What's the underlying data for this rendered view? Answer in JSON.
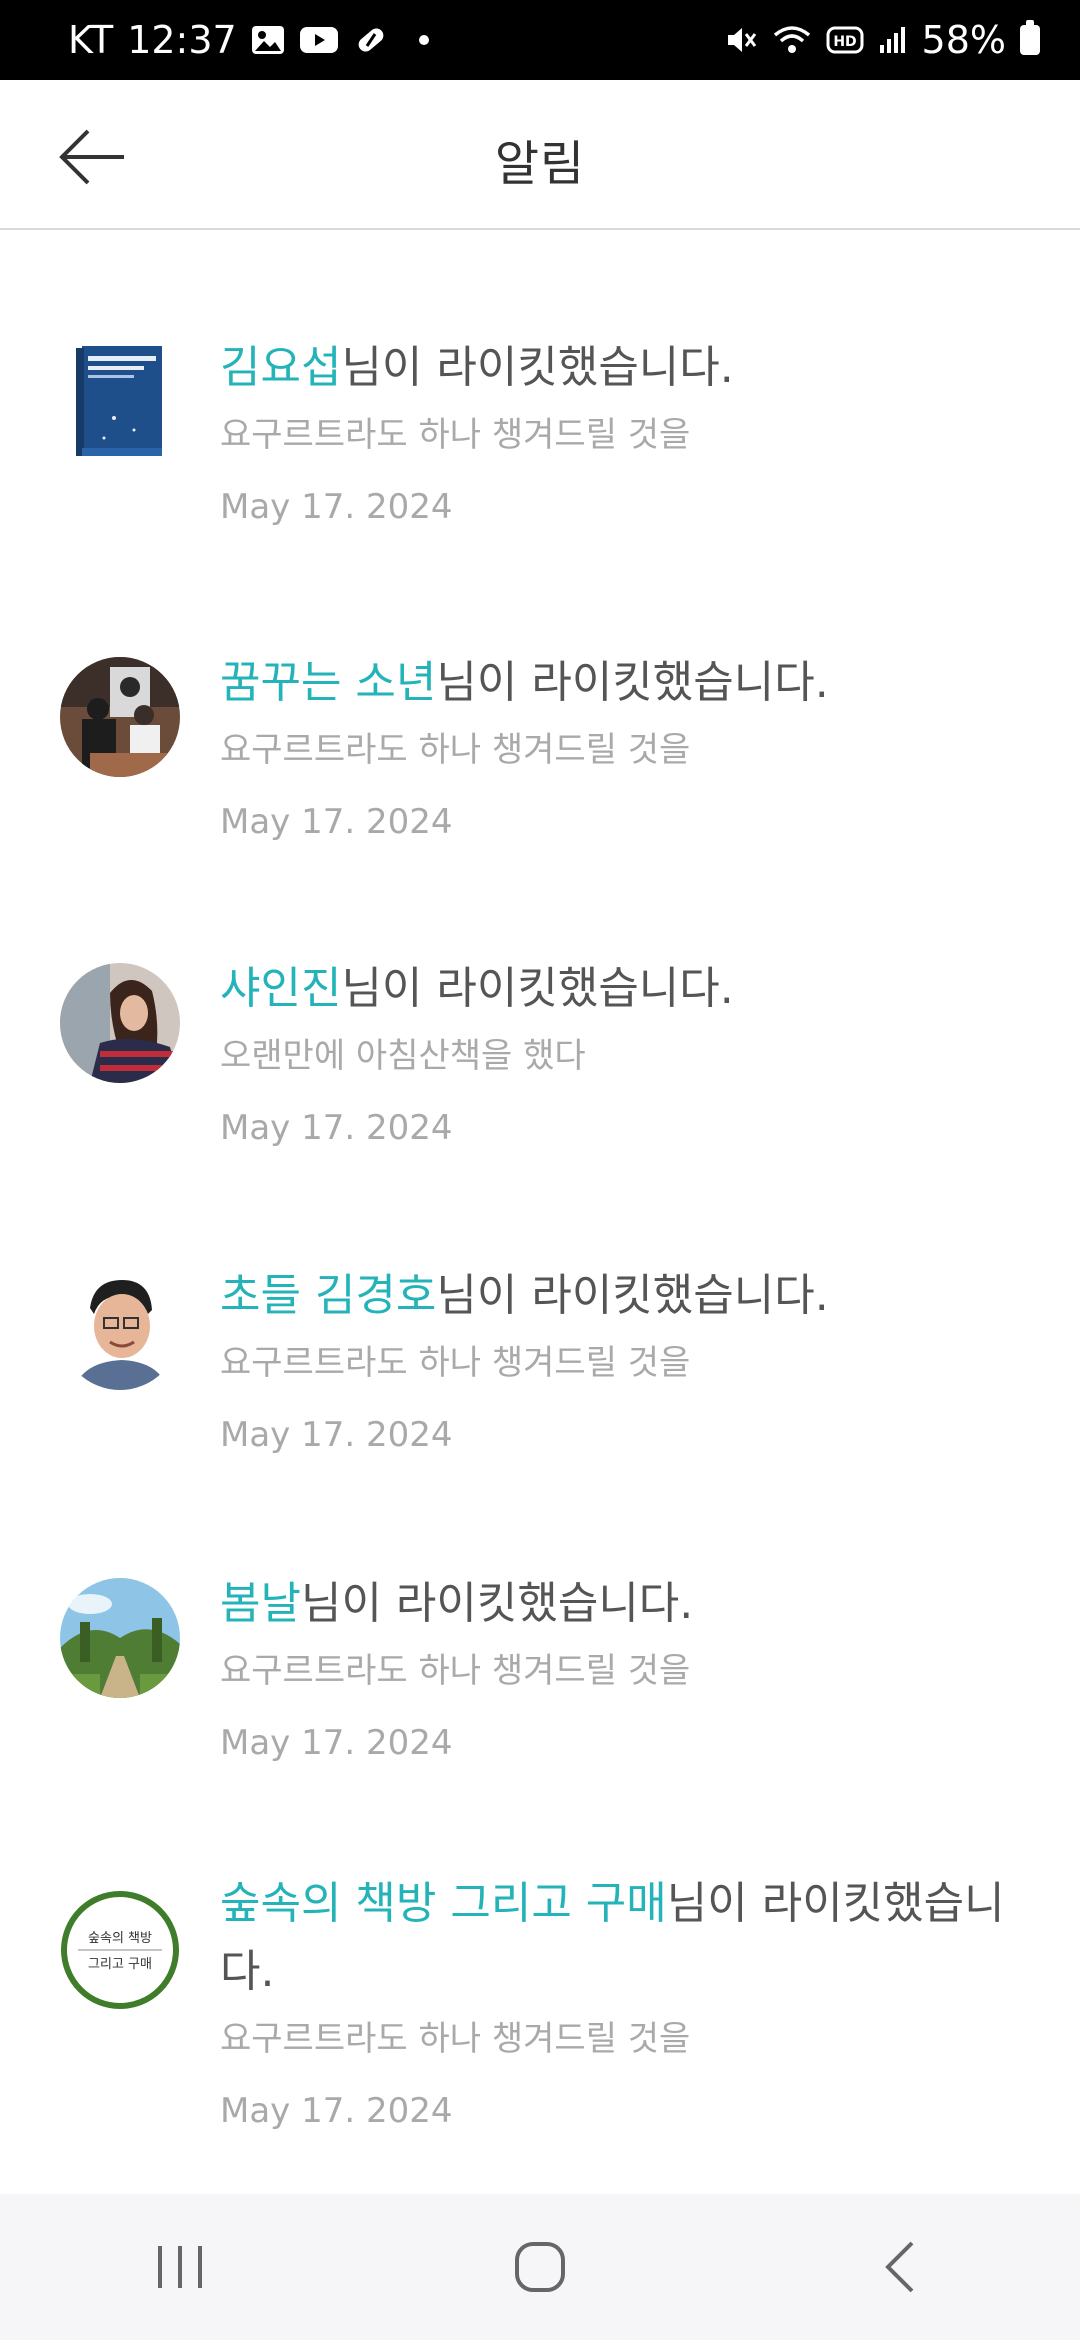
{
  "status_bar": {
    "carrier": "KT",
    "time": "12:37",
    "battery": "58%",
    "icons": [
      "gallery-icon",
      "youtube-icon",
      "pill-icon",
      "notification-dot",
      "mute-icon",
      "wifi-icon",
      "hd-icon",
      "signal-icon",
      "battery-icon"
    ]
  },
  "header": {
    "title": "알림",
    "back_icon": "arrow-left-icon"
  },
  "notifications": [
    {
      "name": "김요섭",
      "action": "님이 라이킷했습니다.",
      "excerpt": "요구르트라도 하나 챙겨드릴 것을",
      "date": "May 17. 2024",
      "avatar": "book-cover"
    },
    {
      "name": "꿈꾸는 소년",
      "action": "님이 라이킷했습니다.",
      "excerpt": "요구르트라도 하나 챙겨드릴 것을",
      "date": "May 17. 2024",
      "avatar": "photo-people"
    },
    {
      "name": "샤인진",
      "action": "님이 라이킷했습니다.",
      "excerpt": "오랜만에 아침산책을 했다",
      "date": "May 17. 2024",
      "avatar": "photo-woman"
    },
    {
      "name": "초들 김경호",
      "action": "님이 라이킷했습니다.",
      "excerpt": "요구르트라도 하나 챙겨드릴 것을",
      "date": "May 17. 2024",
      "avatar": "photo-man"
    },
    {
      "name": "봄날",
      "action": "님이 라이킷했습니다.",
      "excerpt": "요구르트라도 하나 챙겨드릴 것을",
      "date": "May 17. 2024",
      "avatar": "photo-landscape"
    },
    {
      "name": "숲속의 책방 그리고 구매",
      "action": "님이 라이킷했습니다.",
      "excerpt": "요구르트라도 하나 챙겨드릴 것을",
      "date": "May 17. 2024",
      "avatar": "logo-circle",
      "avatar_text": [
        "숲속의 책방",
        "그리고 구매"
      ]
    }
  ],
  "nav_bar": {
    "recent_icon": "recent-apps-icon",
    "home_icon": "home-icon",
    "back_icon": "back-icon"
  },
  "colors": {
    "accent": "#23b3b8",
    "text": "#555555",
    "muted": "#a9a9a9"
  }
}
